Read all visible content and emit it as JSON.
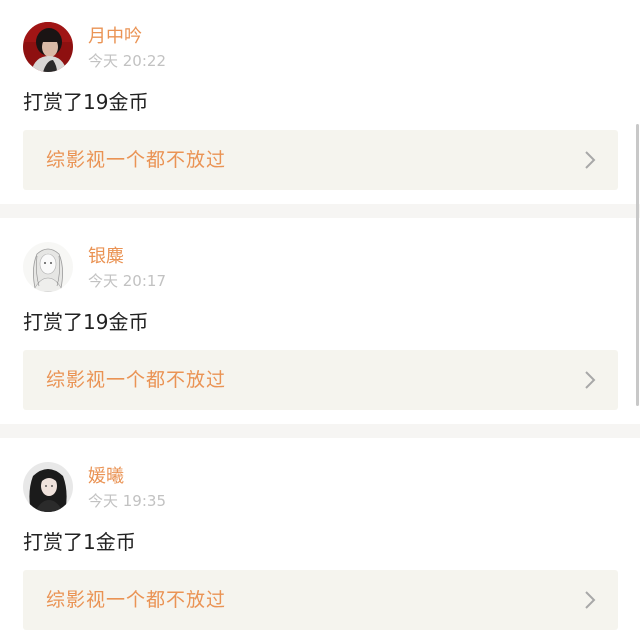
{
  "feed": {
    "items": [
      {
        "username": "月中吟",
        "time": "今天 20:22",
        "reward": "打赏了19金币",
        "book_title": "综影视一个都不放过",
        "avatar_icon": "avatar-dark-hair-red-background"
      },
      {
        "username": "银麋",
        "time": "今天 20:17",
        "reward": "打赏了19金币",
        "book_title": "综影视一个都不放过",
        "avatar_icon": "avatar-sketch-white-hair-girl"
      },
      {
        "username": "媛曦",
        "time": "今天 19:35",
        "reward": "打赏了1金币",
        "book_title": "综影视一个都不放过",
        "avatar_icon": "avatar-long-black-hair-girl"
      }
    ]
  },
  "colors": {
    "accent": "#ea9354",
    "timestamp": "#c2c2c2",
    "card_background": "#f5f4ee",
    "separator": "#f6f5f3",
    "text": "#222222"
  }
}
